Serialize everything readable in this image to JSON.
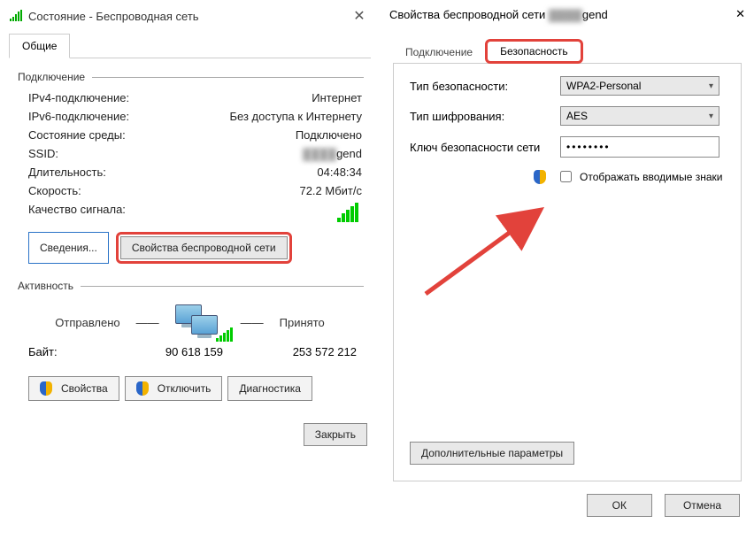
{
  "left": {
    "title": "Состояние - Беспроводная сеть",
    "tab1": "Общие",
    "grp_conn": "Подключение",
    "ipv4_l": "IPv4-подключение:",
    "ipv4_v": "Интернет",
    "ipv6_l": "IPv6-подключение:",
    "ipv6_v": "Без доступа к Интернету",
    "env_l": "Состояние среды:",
    "env_v": "Подключено",
    "ssid_l": "SSID:",
    "ssid_v": "gend",
    "dur_l": "Длительность:",
    "dur_v": "04:48:34",
    "spd_l": "Скорость:",
    "spd_v": "72.2 Мбит/с",
    "sig_l": "Качество сигнала:",
    "btn_details": "Сведения...",
    "btn_wprops": "Свойства беспроводной сети",
    "grp_act": "Активность",
    "sent_l": "Отправлено",
    "recv_l": "Принято",
    "bytes_l": "Байт:",
    "bytes_sent": "90 618 159",
    "bytes_recv": "253 572 212",
    "btn_props": "Свойства",
    "btn_disc": "Отключить",
    "btn_diag": "Диагностика",
    "btn_close": "Закрыть"
  },
  "right": {
    "title_pre": "Свойства беспроводной сети ",
    "title_blur": "▓▓▓▓",
    "title_post": "gend",
    "tab1": "Подключение",
    "tab2": "Безопасность",
    "sectype_l": "Тип безопасности:",
    "sectype_v": "WPA2-Personal",
    "enc_l": "Тип шифрования:",
    "enc_v": "AES",
    "key_l": "Ключ безопасности сети",
    "key_v": "••••••••",
    "showchars": "Отображать вводимые знаки",
    "btn_adv": "Дополнительные параметры",
    "btn_ok": "ОК",
    "btn_cancel": "Отмена"
  }
}
